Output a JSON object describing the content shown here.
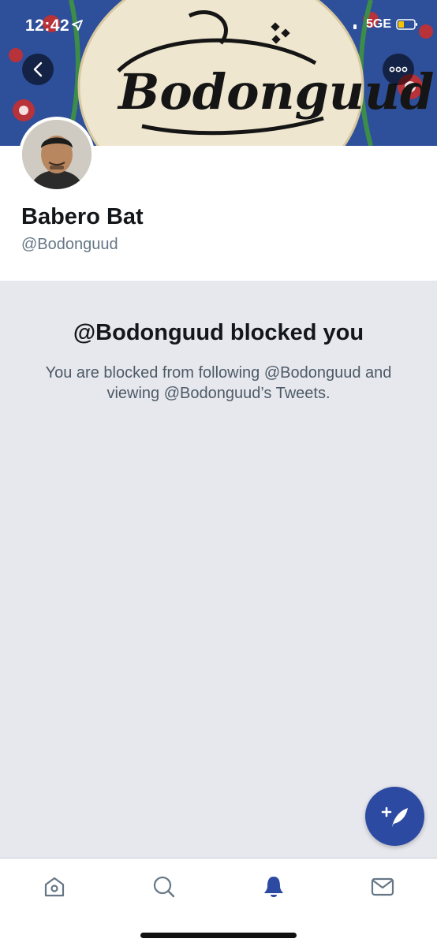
{
  "status_bar": {
    "time": "12:42",
    "network": "5GE"
  },
  "banner": {
    "artwork_text": "Bodonguud"
  },
  "profile": {
    "display_name": "Babero Bat",
    "handle": "@Bodonguud"
  },
  "blocked": {
    "title": "@Bodonguud blocked you",
    "description": "You are blocked from following @Bodonguud and viewing @Bodonguud’s Tweets."
  },
  "tabs": [
    {
      "icon": "home-icon",
      "active": false
    },
    {
      "icon": "search-icon",
      "active": false
    },
    {
      "icon": "notifications-bell-icon",
      "active": true
    },
    {
      "icon": "messages-envelope-icon",
      "active": false
    }
  ],
  "colors": {
    "brand_blue": "#2d4aa3",
    "active_tab": "#2d4aa3",
    "blocked_background": "#e6e8ee"
  }
}
